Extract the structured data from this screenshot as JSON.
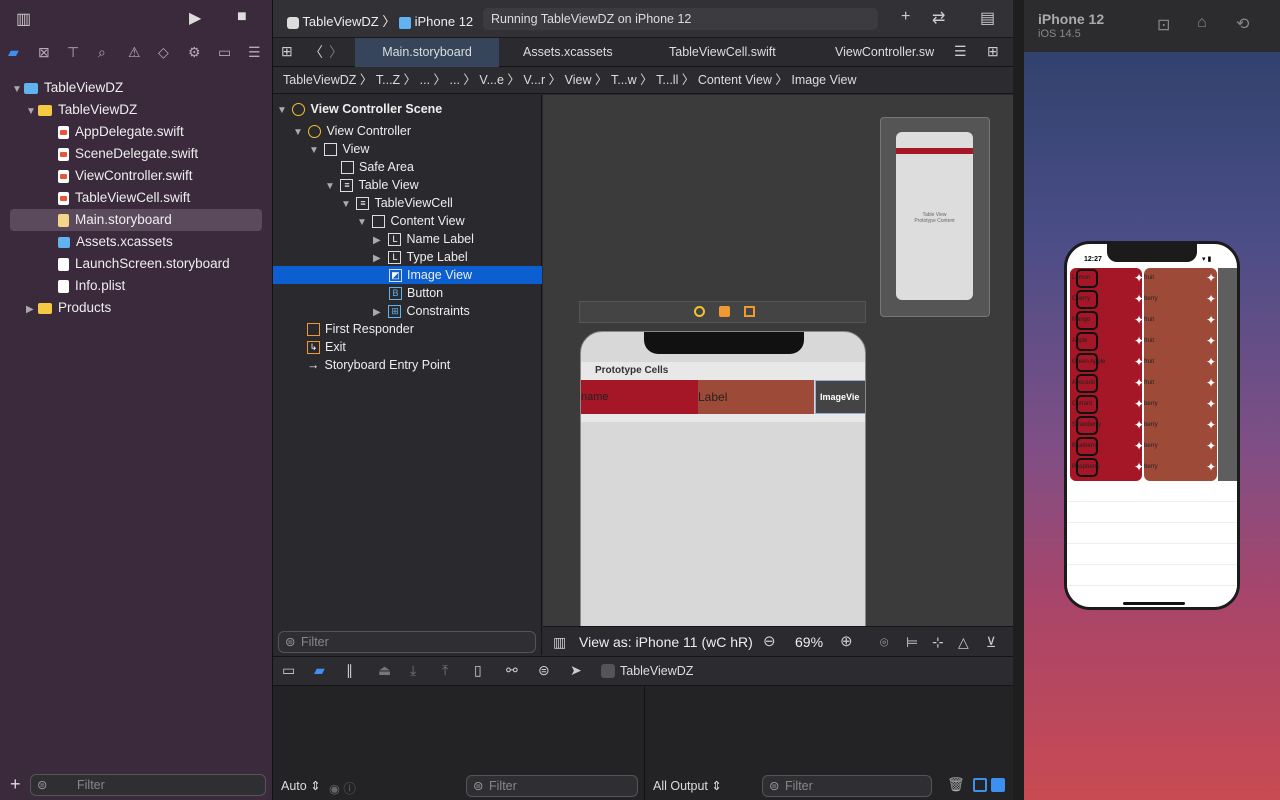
{
  "navigator": {
    "project": "TableViewDZ",
    "group": "TableViewDZ",
    "files": [
      "AppDelegate.swift",
      "SceneDelegate.swift",
      "ViewController.swift",
      "TableViewCell.swift",
      "Main.storyboard",
      "Assets.xcassets",
      "LaunchScreen.storyboard",
      "Info.plist"
    ],
    "products": "Products",
    "filter_placeholder": "Filter"
  },
  "toolbar": {
    "scheme": "TableViewDZ",
    "device": "iPhone 12",
    "status": "Running TableViewDZ on iPhone 12"
  },
  "tabs": [
    "Main.storyboard",
    "Assets.xcassets",
    "TableViewCell.swift",
    "ViewController.sw"
  ],
  "jumpbar": [
    "TableViewDZ",
    "T...Z",
    "...",
    "...",
    "V...e",
    "V...r",
    "View",
    "T...w",
    "T...ll",
    "Content View",
    "Image View"
  ],
  "outline": {
    "rows": [
      "View Controller Scene",
      "View Controller",
      "View",
      "Safe Area",
      "Table View",
      "TableViewCell",
      "Content View",
      "Name Label",
      "Type Label",
      "Image View",
      "Button",
      "Constraints",
      "First Responder",
      "Exit",
      "Storyboard Entry Point"
    ],
    "filter_placeholder": "Filter"
  },
  "canvas": {
    "prototype_cells": "Prototype Cells",
    "cell_name": "name",
    "cell_label": "Label",
    "cell_image": "ImageVie",
    "view_as": "View as: iPhone 11 (wC hR)",
    "zoom": "69%",
    "minimap_text": "Table View\nPrototype Content"
  },
  "debug": {
    "target": "TableViewDZ",
    "auto": "Auto",
    "output": "All Output",
    "filter_placeholder": "Filter"
  },
  "simulator": {
    "device": "iPhone 12",
    "os": "iOS 14.5",
    "time": "12:27",
    "rows": [
      {
        "name": "Lemon",
        "type": "fruit"
      },
      {
        "name": "Cherry",
        "type": "berry"
      },
      {
        "name": "Mango",
        "type": "fruit"
      },
      {
        "name": "Apple",
        "type": "fruit"
      },
      {
        "name": "Green Apple",
        "type": "fruit"
      },
      {
        "name": "Avocado",
        "type": "fruit"
      },
      {
        "name": "Currant",
        "type": "berry"
      },
      {
        "name": "Strawberry",
        "type": "berry"
      },
      {
        "name": "Blueberry",
        "type": "berry"
      },
      {
        "name": "Raspberry",
        "type": "berry"
      }
    ]
  },
  "colors": {
    "accent": "#0b5fd0",
    "cell_name": "#a51626",
    "cell_type": "#9e4a38"
  }
}
